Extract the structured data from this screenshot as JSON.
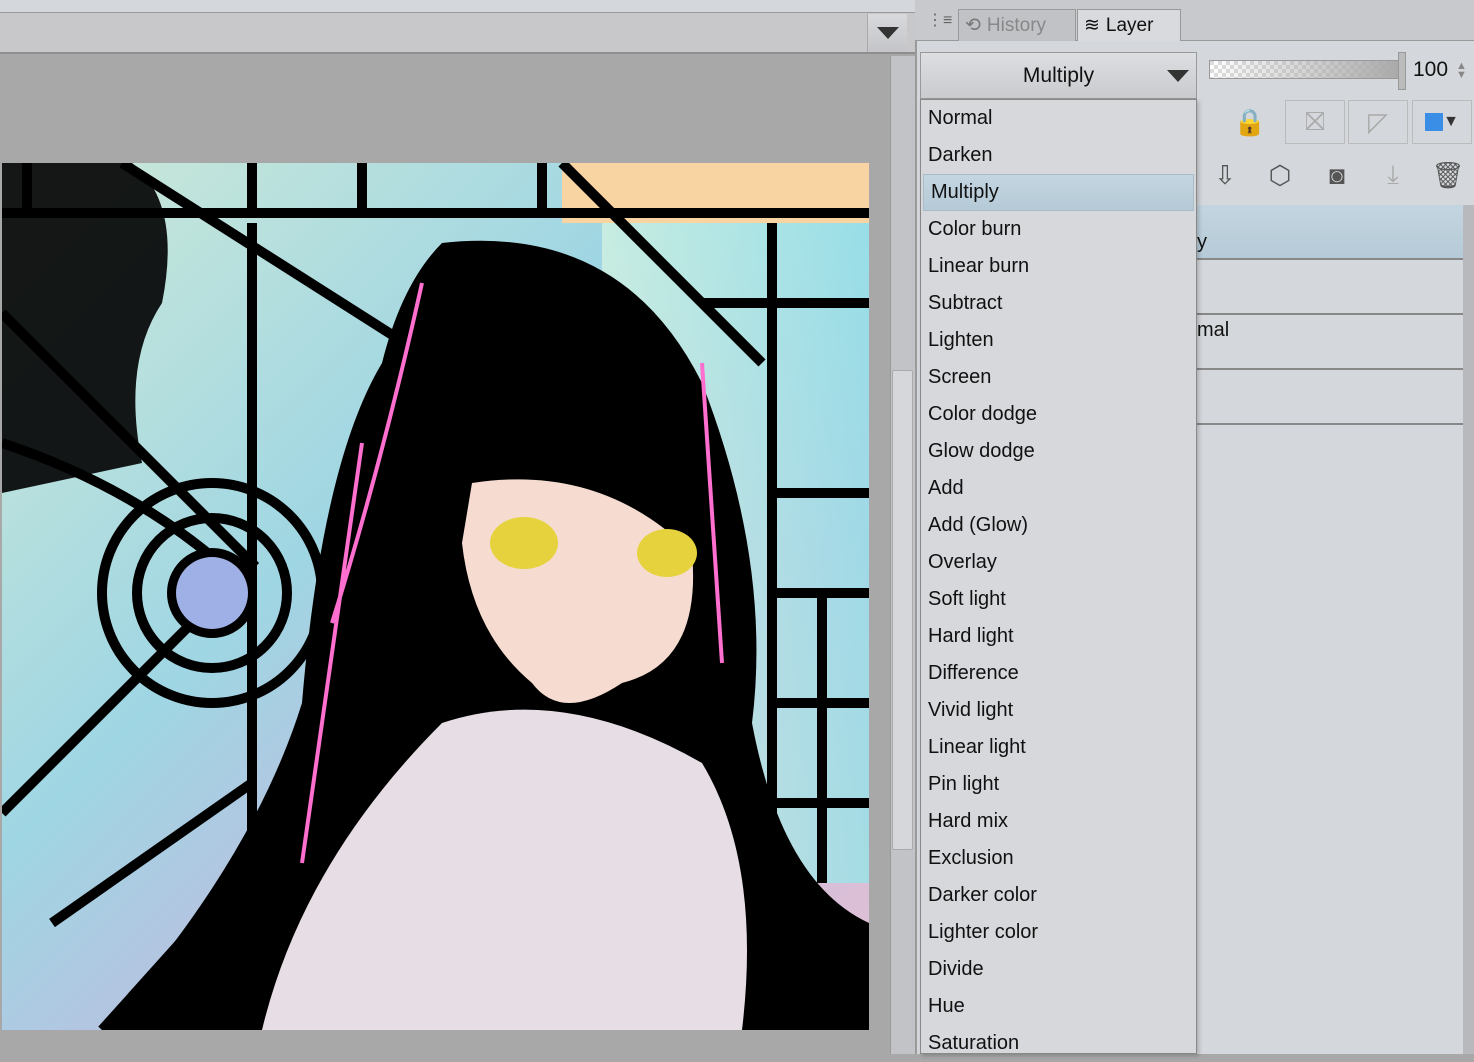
{
  "panel_tabs": [
    {
      "label": "History",
      "icon": "history-icon"
    },
    {
      "label": "Layer",
      "icon": "layers-icon"
    }
  ],
  "blend_mode": {
    "selected": "Multiply",
    "options": [
      "Normal",
      "Darken",
      "Multiply",
      "Color burn",
      "Linear burn",
      "Subtract",
      "Lighten",
      "Screen",
      "Color dodge",
      "Glow dodge",
      "Add",
      "Add (Glow)",
      "Overlay",
      "Soft light",
      "Hard light",
      "Difference",
      "Vivid light",
      "Linear light",
      "Pin light",
      "Hard mix",
      "Exclusion",
      "Darker color",
      "Lighter color",
      "Divide",
      "Hue",
      "Saturation"
    ]
  },
  "opacity": {
    "value": "100",
    "percent": 100
  },
  "layer_rows": [
    "y",
    "",
    "mal",
    ""
  ],
  "colors": {
    "accent": "#3a8ee6",
    "selection": "#bcd0dc",
    "panel": "#d4d7db"
  }
}
